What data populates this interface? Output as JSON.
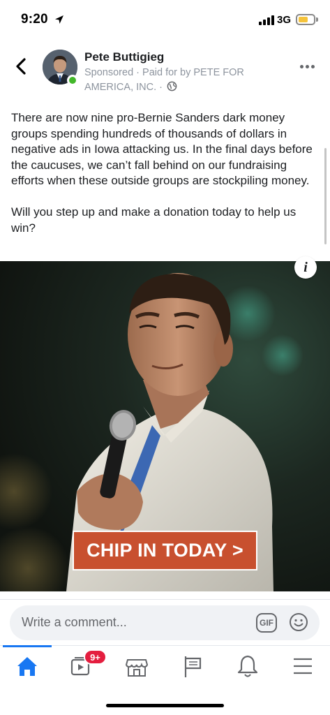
{
  "status_bar": {
    "time": "9:20",
    "network": "3G"
  },
  "post": {
    "page_name": "Pete Buttigieg",
    "meta": "Sponsored · Paid for by PETE FOR AMERICA, INC. ·",
    "paragraphs": [
      "There are now nine pro-Bernie Sanders dark money groups spending hundreds of thousands of dollars in negative ads in Iowa attacking us. In the final days before the caucuses, we can’t fall behind on our fundraising efforts when these outside groups are stockpiling money.",
      "Will you step up and make a donation today to help us win?"
    ],
    "cta_label": "CHIP IN TODAY >",
    "info_label": "i"
  },
  "comment_bar": {
    "placeholder": "Write a comment...",
    "gif_label": "GIF"
  },
  "tab_bar": {
    "tabs": [
      "home-icon",
      "watch-icon",
      "marketplace-icon",
      "pages-flag-icon",
      "notifications-bell-icon",
      "menu-icon"
    ],
    "watch_badge": "9+"
  },
  "colors": {
    "accent": "#1877f2",
    "cta_background": "#c8502f",
    "online": "#42b72a",
    "badge": "#e41e3f"
  }
}
